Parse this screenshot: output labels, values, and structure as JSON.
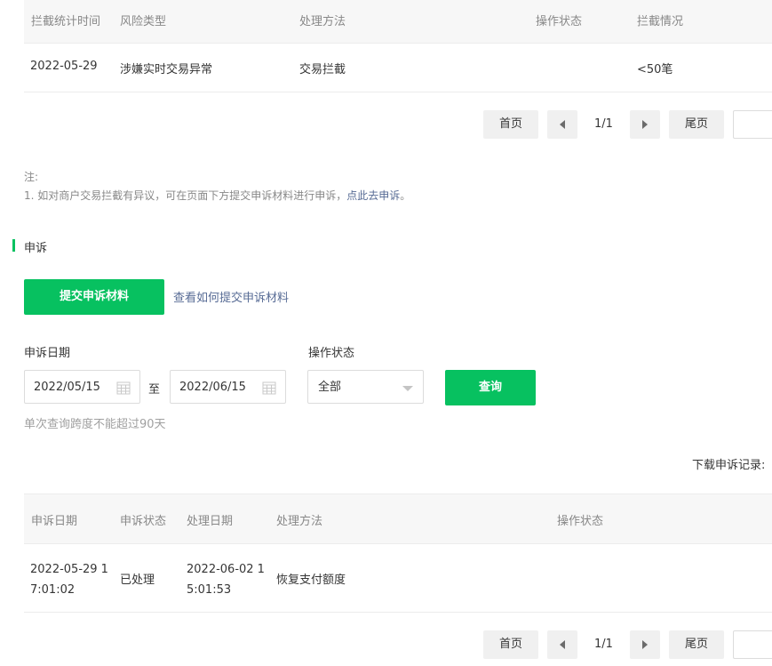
{
  "interception_table": {
    "headers": [
      "拦截统计时间",
      "风险类型",
      "处理方法",
      "操作状态",
      "拦截情况"
    ],
    "rows": [
      [
        "2022-05-29",
        "涉嫌实时交易异常",
        "交易拦截",
        "",
        "<50笔"
      ]
    ]
  },
  "pagination_top": {
    "first": "首页",
    "page": "1/1",
    "last": "尾页"
  },
  "note": {
    "title": "注:",
    "line1_prefix": "1.  如对商户交易拦截有异议，可在页面下方提交申诉材料进行申诉，",
    "line1_link": "点此去申诉",
    "line1_suffix": "。"
  },
  "appeal_section": {
    "title": "申诉",
    "submit_button": "提交申诉材料",
    "help_link": "查看如何提交申诉材料"
  },
  "filters": {
    "date_label": "申诉日期",
    "start_date": "2022/05/15",
    "to_label": "至",
    "end_date": "2022/06/15",
    "status_label": "操作状态",
    "status_value": "全部",
    "query_button": "查询",
    "hint": "单次查询跨度不能超过90天"
  },
  "download_label": "下载申诉记录:",
  "appeal_table": {
    "headers": [
      "申诉日期",
      "申诉状态",
      "处理日期",
      "处理方法",
      "操作状态"
    ],
    "rows": [
      {
        "appeal_date_1": "2022-05-29 1",
        "appeal_date_2": "7:01:02",
        "status": "已处理",
        "handle_date_1": "2022-06-02 1",
        "handle_date_2": "5:01:53",
        "method": "恢复支付额度",
        "op_status": ""
      }
    ]
  },
  "pagination_bottom": {
    "first": "首页",
    "page": "1/1",
    "last": "尾页"
  },
  "colors": {
    "accent_green": "#07c160",
    "link_blue": "#576b95",
    "header_bg": "#f7f7f7"
  }
}
